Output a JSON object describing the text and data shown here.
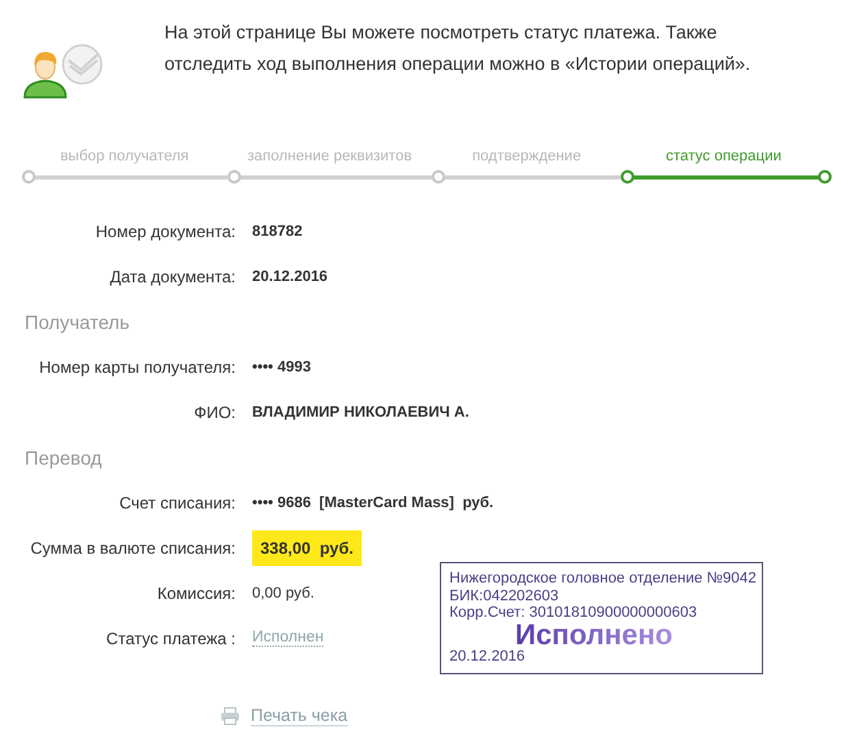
{
  "intro": {
    "text": "На этой странице Вы можете посмотреть статус платежа. Также отследить ход выполнения операции можно в «Истории операций»."
  },
  "steps": [
    {
      "label": "выбор получателя",
      "selected": false
    },
    {
      "label": "заполнение реквизитов",
      "selected": false
    },
    {
      "label": "подтверждение",
      "selected": false
    },
    {
      "label": "статус операции",
      "selected": true
    }
  ],
  "details": [
    {
      "kind": "field",
      "label": "Номер документа:",
      "value": "818782"
    },
    {
      "kind": "field",
      "label": "Дата документа:",
      "value": "20.12.2016"
    },
    {
      "kind": "heading",
      "text": "Получатель"
    },
    {
      "kind": "field",
      "label": "Номер карты получателя:",
      "value": "•••• 4993"
    },
    {
      "kind": "field",
      "label": "ФИО:",
      "value": "ВЛАДИМИР НИКОЛАЕВИЧ А."
    },
    {
      "kind": "heading",
      "text": "Перевод"
    },
    {
      "kind": "field",
      "label": "Счет списания:",
      "value": "•••• 9686  [MasterCard Mass]  руб."
    },
    {
      "kind": "amount",
      "label": "Сумма в валюте списания:",
      "value": "338,00  руб."
    },
    {
      "kind": "plain",
      "label": "Комиссия:",
      "value": "0,00 руб."
    },
    {
      "kind": "link",
      "label": "Статус платежа :",
      "value": "Исполнен"
    }
  ],
  "stamp": {
    "lines": [
      "Нижегородское головное отделение №9042",
      "БИК:042202603",
      "Корр.Счет: 30101810900000000603"
    ],
    "mark": "Исполнено",
    "date": "20.12.2016"
  },
  "print_link": "Печать чека"
}
